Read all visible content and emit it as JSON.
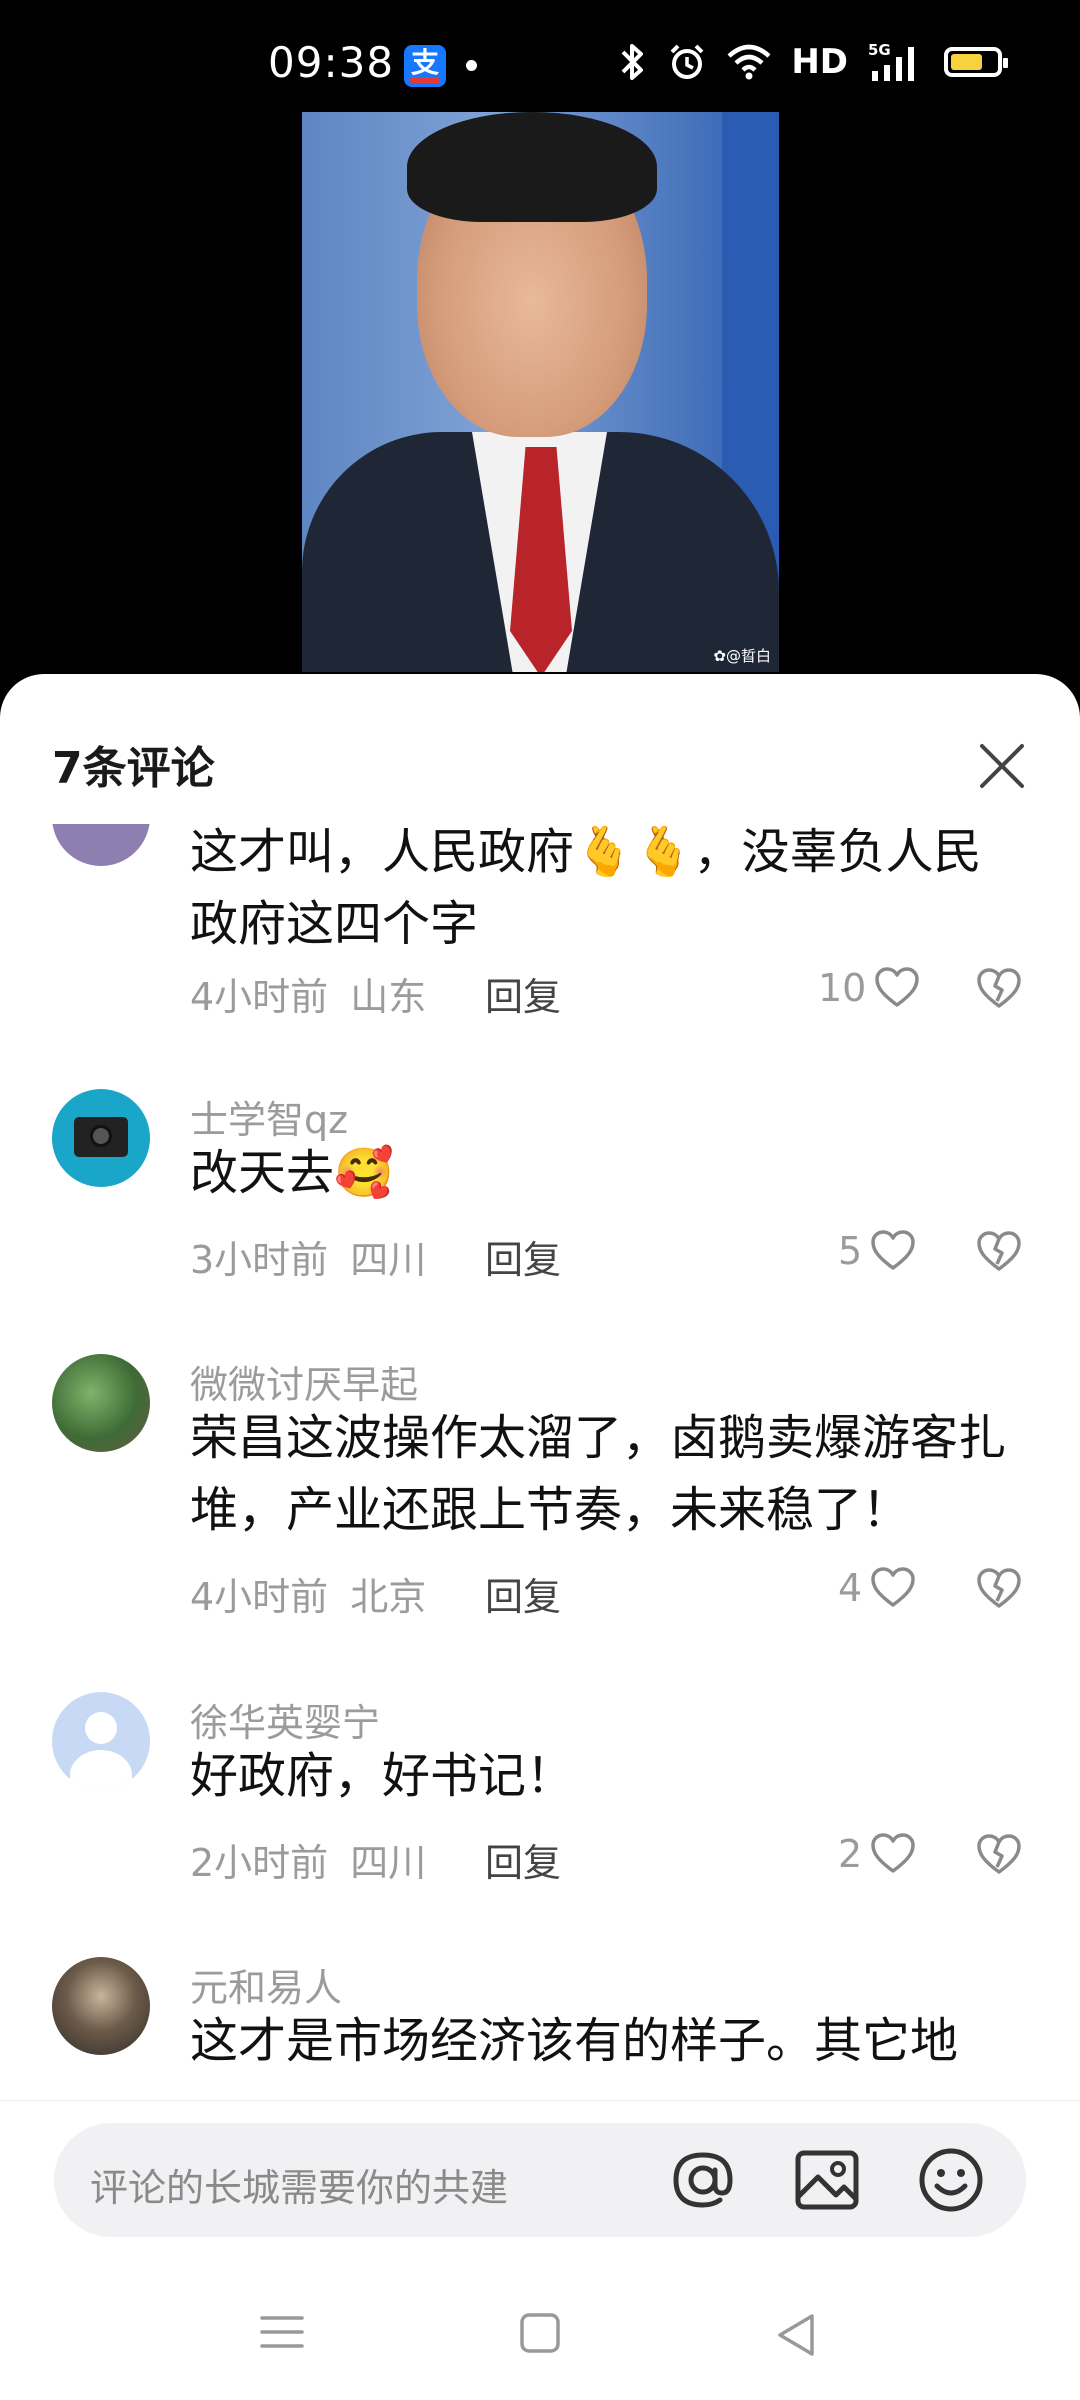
{
  "status_bar": {
    "time": "09:38",
    "notification_app": "支",
    "icons": [
      "bluetooth-icon",
      "alarm-icon",
      "wifi-icon",
      "hd-label",
      "5g-signal-icon",
      "battery-icon"
    ],
    "hd": "HD",
    "network": "5G"
  },
  "video": {
    "watermark": "✿@晢白"
  },
  "comments_panel": {
    "title": "7条评论",
    "comments": [
      {
        "username": "",
        "text": "这才叫，人民政府🫰🫰，没辜负人民政府这四个字",
        "time": "4小时前",
        "location": "山东",
        "reply_label": "回复",
        "likes": "10"
      },
      {
        "username": "士学智qz",
        "text": "改天去🥰",
        "time": "3小时前",
        "location": "四川",
        "reply_label": "回复",
        "likes": "5"
      },
      {
        "username": "微微讨厌早起",
        "text": "荣昌这波操作太溜了，卤鹅卖爆游客扎堆，产业还跟上节奏，未来稳了！",
        "time": "4小时前",
        "location": "北京",
        "reply_label": "回复",
        "likes": "4"
      },
      {
        "username": "徐华英婴宁",
        "text": "好政府，好书记！",
        "time": "2小时前",
        "location": "四川",
        "reply_label": "回复",
        "likes": "2"
      },
      {
        "username": "元和易人",
        "text": "这才是市场经济该有的样子。其它地",
        "time": "",
        "location": "",
        "reply_label": "",
        "likes": ""
      }
    ]
  },
  "input_bar": {
    "placeholder": "评论的长城需要你的共建",
    "icons": [
      "at-icon",
      "image-icon",
      "emoji-icon"
    ]
  },
  "nav_bar": {
    "icons": [
      "menu-icon",
      "home-icon",
      "back-icon"
    ]
  },
  "colors": {
    "battery": "#f6d23c",
    "sheet_bg": "#ffffff",
    "secondary_text": "#9b9b9b"
  }
}
